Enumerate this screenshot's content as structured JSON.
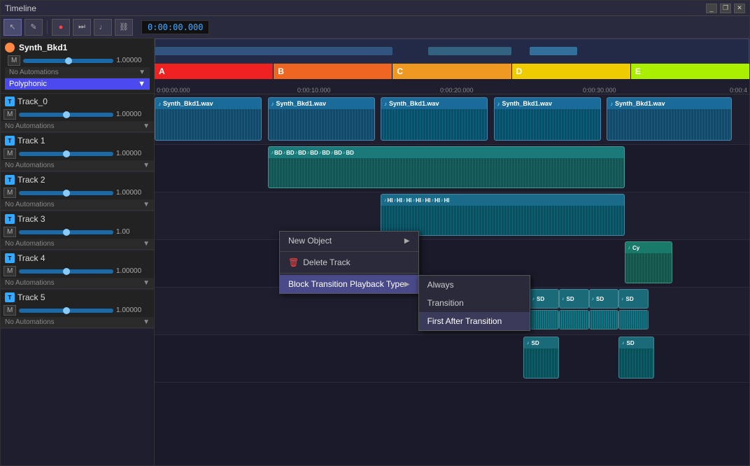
{
  "window": {
    "title": "Timeline"
  },
  "toolbar": {
    "time": "0:00:00.000",
    "time_marks": [
      "0:00:00.000",
      "0:00:10.000",
      "0:00:20.000",
      "0:00:30.000",
      "0:00:4"
    ]
  },
  "synth": {
    "name": "Synth_Bkd1",
    "volume": "1.00000",
    "no_auto": "No Automations",
    "poly": "Polyphonic"
  },
  "tracks": [
    {
      "id": "Track_0",
      "name": "Track_0",
      "volume": "1.00000"
    },
    {
      "id": "Track_1",
      "name": "Track 1",
      "volume": "1.00000"
    },
    {
      "id": "Track_2",
      "name": "Track 2",
      "volume": "1.00000"
    },
    {
      "id": "Track_3",
      "name": "Track 3",
      "volume": "1.00000"
    },
    {
      "id": "Track_4",
      "name": "Track 4",
      "volume": "1.00"
    },
    {
      "id": "Track_5",
      "name": "Track 5",
      "volume": "1.00000"
    }
  ],
  "sections": [
    {
      "label": "A",
      "color": "sec-a"
    },
    {
      "label": "B",
      "color": "sec-b"
    },
    {
      "label": "C",
      "color": "sec-c"
    },
    {
      "label": "D",
      "color": "sec-d"
    },
    {
      "label": "E",
      "color": "sec-e"
    }
  ],
  "context_menu": {
    "items": [
      {
        "label": "New Object",
        "has_sub": true
      },
      {
        "label": "Delete Track",
        "has_icon": true
      },
      {
        "label": "Block Transition Playback Type",
        "has_sub": true,
        "active": true
      }
    ],
    "submenu": {
      "items": [
        {
          "label": "Always"
        },
        {
          "label": "Transition"
        },
        {
          "label": "First After Transition",
          "selected": true
        }
      ]
    }
  }
}
